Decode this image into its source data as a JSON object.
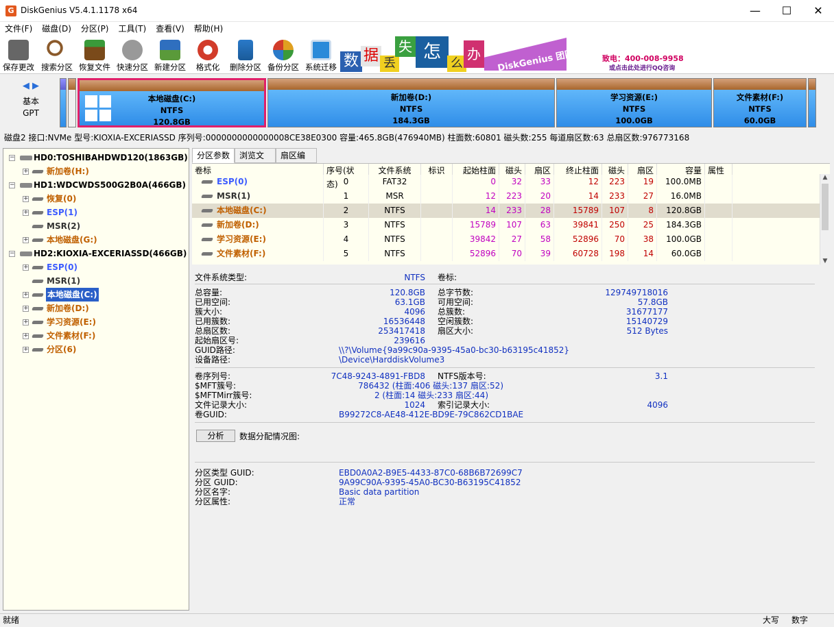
{
  "window": {
    "title": "DiskGenius V5.4.1.1178 x64",
    "icon_text": "G",
    "minimize": "—",
    "maximize": "☐",
    "close": "✕"
  },
  "menu": [
    "文件(F)",
    "磁盘(D)",
    "分区(P)",
    "工具(T)",
    "查看(V)",
    "帮助(H)"
  ],
  "toolbar": [
    {
      "label": "保存更改",
      "icon": "save-icon",
      "color": "#666666"
    },
    {
      "label": "搜索分区",
      "icon": "search-icon",
      "color": "#8b5a2b"
    },
    {
      "label": "恢复文件",
      "icon": "recover-icon",
      "color": "#7a4a1a"
    },
    {
      "label": "快速分区",
      "icon": "quick-partition-icon",
      "color": "#888888"
    },
    {
      "label": "新建分区",
      "icon": "new-partition-icon",
      "color": "#2f6fbf"
    },
    {
      "label": "格式化",
      "icon": "format-icon",
      "color": "#d23c2a"
    },
    {
      "label": "删除分区",
      "icon": "delete-icon",
      "color": "#2a7ac9"
    },
    {
      "label": "备份分区",
      "icon": "backup-icon",
      "color": "#e0a020"
    },
    {
      "label": "系统迁移",
      "icon": "migrate-icon",
      "color": "#2a8ad9"
    }
  ],
  "banner": {
    "chars": [
      "数",
      "据",
      "丢",
      "失",
      "怎",
      "么",
      "办"
    ],
    "slogan": "DiskGenius 团队为您服务",
    "phone": "致电：400-008-9958",
    "qq": "或点击此处进行QQ咨询"
  },
  "disk_map": {
    "kind": "基本",
    "scheme": "GPT",
    "partitions": [
      {
        "name": "本地磁盘(C:)",
        "fs": "NTFS",
        "size": "120.8GB"
      },
      {
        "name": "新加卷(D:)",
        "fs": "NTFS",
        "size": "184.3GB"
      },
      {
        "name": "学习资源(E:)",
        "fs": "NTFS",
        "size": "100.0GB"
      },
      {
        "name": "文件素材(F:)",
        "fs": "NTFS",
        "size": "60.0GB"
      }
    ]
  },
  "disk_line": "磁盘2 接口:NVMe  型号:KIOXIA-EXCERIASSD  序列号:0000000000000008CE38E0300  容量:465.8GB(476940MB)  柱面数:60801  磁头数:255  每道扇区数:63  总扇区数:976773168",
  "tree": {
    "disks": [
      {
        "label": "HD0:TOSHIBAHDWD120(1863GB)",
        "expander": "−",
        "children": [
          {
            "label": "新加卷(H:)",
            "color": "orange",
            "expander": "+"
          }
        ]
      },
      {
        "label": "HD1:WDCWDS500G2B0A(466GB)",
        "expander": "−",
        "children": [
          {
            "label": "恢复(0)",
            "color": "orange",
            "expander": "+"
          },
          {
            "label": "ESP(1)",
            "color": "blue",
            "expander": "+"
          },
          {
            "label": "MSR(2)",
            "color": "gray",
            "expander": ""
          },
          {
            "label": "本地磁盘(G:)",
            "color": "orange",
            "expander": "+"
          }
        ]
      },
      {
        "label": "HD2:KIOXIA-EXCERIASSD(466GB)",
        "expander": "−",
        "children": [
          {
            "label": "ESP(0)",
            "color": "blue",
            "expander": "+"
          },
          {
            "label": "MSR(1)",
            "color": "gray",
            "expander": ""
          },
          {
            "label": "本地磁盘(C:)",
            "color": "selected",
            "expander": "+"
          },
          {
            "label": "新加卷(D:)",
            "color": "orange",
            "expander": "+"
          },
          {
            "label": "学习资源(E:)",
            "color": "orange",
            "expander": "+"
          },
          {
            "label": "文件素材(F:)",
            "color": "orange",
            "expander": "+"
          },
          {
            "label": "分区(6)",
            "color": "orange",
            "expander": "+"
          }
        ]
      }
    ]
  },
  "tabs": [
    "分区参数",
    "浏览文件",
    "扇区编辑"
  ],
  "table": {
    "headers": [
      "卷标",
      "序号(状态)",
      "文件系统",
      "标识",
      "起始柱面",
      "磁头",
      "扇区",
      "终止柱面",
      "磁头",
      "扇区",
      "容量",
      "属性"
    ],
    "rows": [
      {
        "label": "ESP(0)",
        "color": "blue",
        "num": "0",
        "fs": "FAT32",
        "flag": "",
        "sc": "0",
        "sh": "32",
        "ss": "33",
        "ec": "12",
        "eh": "223",
        "es": "19",
        "cap": "100.0MB",
        "attr": ""
      },
      {
        "label": "MSR(1)",
        "color": "gray",
        "num": "1",
        "fs": "MSR",
        "flag": "",
        "sc": "12",
        "sh": "223",
        "ss": "20",
        "ec": "14",
        "eh": "233",
        "es": "27",
        "cap": "16.0MB",
        "attr": ""
      },
      {
        "label": "本地磁盘(C:)",
        "color": "orange",
        "num": "2",
        "fs": "NTFS",
        "flag": "",
        "sc": "14",
        "sh": "233",
        "ss": "28",
        "ec": "15789",
        "eh": "107",
        "es": "8",
        "cap": "120.8GB",
        "attr": ""
      },
      {
        "label": "新加卷(D:)",
        "color": "orange",
        "num": "3",
        "fs": "NTFS",
        "flag": "",
        "sc": "15789",
        "sh": "107",
        "ss": "63",
        "ec": "39841",
        "eh": "250",
        "es": "25",
        "cap": "184.3GB",
        "attr": ""
      },
      {
        "label": "学习资源(E:)",
        "color": "orange",
        "num": "4",
        "fs": "NTFS",
        "flag": "",
        "sc": "39842",
        "sh": "27",
        "ss": "58",
        "ec": "52896",
        "eh": "70",
        "es": "38",
        "cap": "100.0GB",
        "attr": ""
      },
      {
        "label": "文件素材(F:)",
        "color": "orange",
        "num": "5",
        "fs": "NTFS",
        "flag": "",
        "sc": "52896",
        "sh": "70",
        "ss": "39",
        "ec": "60728",
        "eh": "198",
        "es": "14",
        "cap": "60.0GB",
        "attr": ""
      }
    ]
  },
  "details": {
    "fs_type_label": "文件系统类型:",
    "fs_type_value": "NTFS",
    "vol_label_label": "卷标:",
    "left": [
      {
        "k": "总容量:",
        "v": "120.8GB"
      },
      {
        "k": "已用空间:",
        "v": "63.1GB"
      },
      {
        "k": "簇大小:",
        "v": "4096"
      },
      {
        "k": "已用簇数:",
        "v": "16536448"
      },
      {
        "k": "总扇区数:",
        "v": "253417418"
      },
      {
        "k": "起始扇区号:",
        "v": "239616"
      }
    ],
    "right": [
      {
        "k": "总字节数:",
        "v": "129749718016"
      },
      {
        "k": "可用空间:",
        "v": "57.8GB"
      },
      {
        "k": "总簇数:",
        "v": "31677177"
      },
      {
        "k": "空闲簇数:",
        "v": "15140729"
      },
      {
        "k": "扇区大小:",
        "v": "512 Bytes"
      }
    ],
    "guid_path_label": "GUID路径:",
    "guid_path": "\\\\?\\Volume{9a99c90a-9395-45a0-bc30-b63195c41852}",
    "device_path_label": "设备路径:",
    "device_path": "\\Device\\HarddiskVolume3",
    "serial_label": "卷序列号:",
    "serial": "7C48-9243-4891-FBD8",
    "ntfs_ver_label": "NTFS版本号:",
    "ntfs_ver": "3.1",
    "mft_label": "$MFT簇号:",
    "mft": "786432 (柱面:406 磁头:137 扇区:52)",
    "mftmirr_label": "$MFTMirr簇号:",
    "mftmirr": "2 (柱面:14 磁头:233 扇区:44)",
    "record_label": "文件记录大小:",
    "record": "1024",
    "index_label": "索引记录大小:",
    "index": "4096",
    "volguid_label": "卷GUID:",
    "volguid": "B99272C8-AE48-412E-BD9E-79C862CD1BAE",
    "analyze": "分析",
    "alloc_label": "数据分配情况图:",
    "ptype_label": "分区类型 GUID:",
    "ptype": "EBD0A0A2-B9E5-4433-87C0-68B6B72699C7",
    "pguid_label": "分区 GUID:",
    "pguid": "9A99C90A-9395-45A0-BC30-B63195C41852",
    "pname_label": "分区名字:",
    "pname": "Basic data partition",
    "pattr_label": "分区属性:",
    "pattr": "正常"
  },
  "status": {
    "left": "就绪",
    "caps": "大写",
    "num": "数字"
  },
  "colors": {
    "orange": "#c06000",
    "blue": "#3b5bff",
    "magenta": "#c000c0",
    "red": "#c00000",
    "selection": "#2a5fc8"
  }
}
